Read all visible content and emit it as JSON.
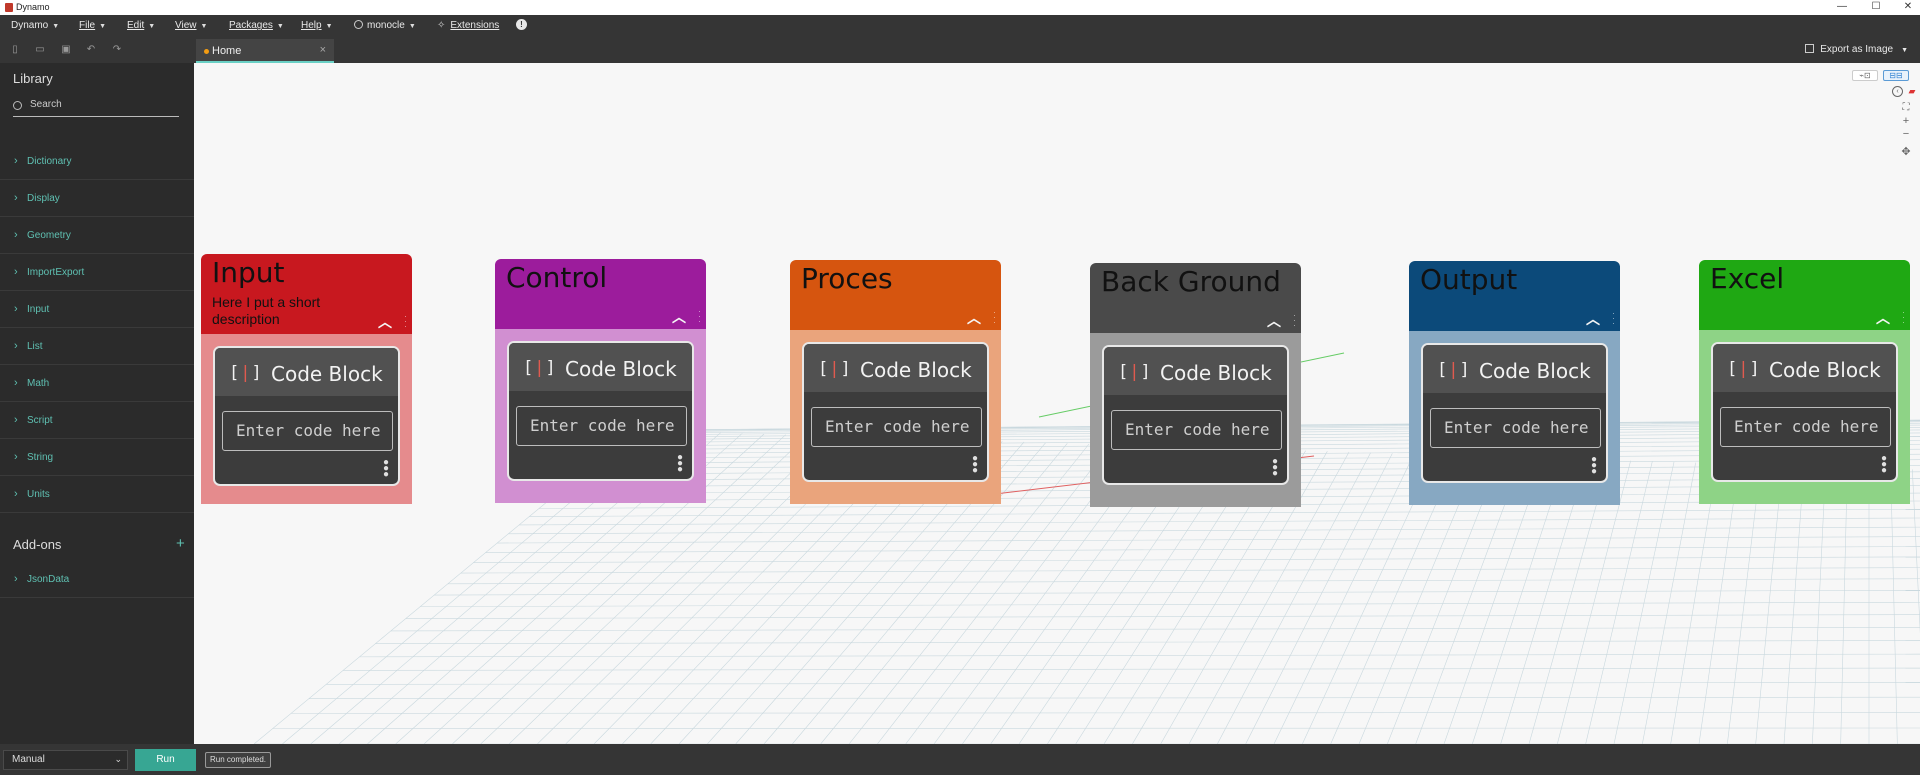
{
  "window": {
    "title": "Dynamo",
    "controls": [
      "—",
      "☐",
      "✕"
    ]
  },
  "menubar": {
    "items": [
      {
        "label": "Dynamo",
        "has_dropdown": true
      },
      {
        "label": "File",
        "has_dropdown": true
      },
      {
        "label": "Edit",
        "has_dropdown": true
      },
      {
        "label": "View",
        "has_dropdown": true
      },
      {
        "label": "Packages",
        "has_dropdown": true
      },
      {
        "label": "Help",
        "has_dropdown": true
      },
      {
        "label": "monocle",
        "has_dropdown": true
      },
      {
        "label": "Extensions",
        "has_dropdown": false
      }
    ]
  },
  "toolbar": {
    "icons": [
      "new-file-icon",
      "open-folder-icon",
      "save-icon",
      "undo-icon",
      "redo-icon"
    ],
    "tab": {
      "label": "Home",
      "close": "×",
      "accent_color": "#f39c12"
    },
    "export_label": "Export as Image"
  },
  "library": {
    "title": "Library",
    "search_placeholder": "Search",
    "categories": [
      "Dictionary",
      "Display",
      "Geometry",
      "ImportExport",
      "Input",
      "List",
      "Math",
      "Script",
      "String",
      "Units"
    ],
    "addons_title": "Add-ons",
    "addons": [
      "JsonData"
    ]
  },
  "groups": [
    {
      "title": "Input",
      "description": "Here I put a short description",
      "header_color": "#c8181f",
      "body_color": "#e58b8d",
      "node_title": "Code Block",
      "node_placeholder": "Enter code here"
    },
    {
      "title": "Control",
      "description": "",
      "header_color": "#9c1c9c",
      "body_color": "#d18fd1",
      "node_title": "Code Block",
      "node_placeholder": "Enter code here"
    },
    {
      "title": "Proces",
      "description": "",
      "header_color": "#d6550f",
      "body_color": "#eaa47c",
      "node_title": "Code Block",
      "node_placeholder": "Enter code here"
    },
    {
      "title": "Back Ground",
      "description": "",
      "header_color": "#4a4a4a",
      "body_color": "#9b9b9b",
      "node_title": "Code Block",
      "node_placeholder": "Enter code here"
    },
    {
      "title": "Output",
      "description": "",
      "header_color": "#0c4a7a",
      "body_color": "#87a8c2",
      "node_title": "Code Block",
      "node_placeholder": "Enter code here"
    },
    {
      "title": "Excel",
      "description": "",
      "header_color": "#1fa813",
      "body_color": "#8ed386",
      "node_title": "Code Block",
      "node_placeholder": "Enter code here"
    }
  ],
  "bottombar": {
    "run_mode": "Manual",
    "run_label": "Run",
    "status": "Run completed."
  }
}
